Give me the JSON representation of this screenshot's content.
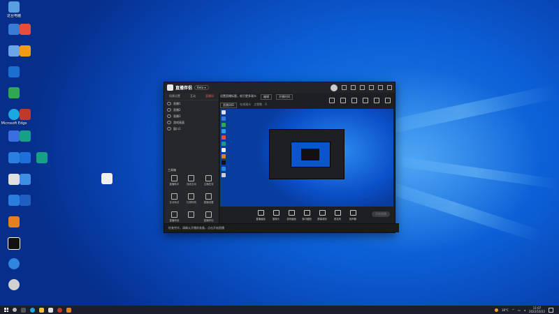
{
  "desktop": {
    "icons": [
      {
        "label": "这台电脑",
        "color": "#5aa0e0"
      },
      {
        "label": "",
        "color": "#3a7bd5"
      },
      {
        "label": "",
        "color": "#6aa6e8"
      },
      {
        "label": "",
        "color": "#1a6fd0"
      },
      {
        "label": "",
        "color": "#2fa84f"
      },
      {
        "label": "Microsoft Edge",
        "color": "#1ca7e0"
      },
      {
        "label": "",
        "color": "#3b6ee0"
      },
      {
        "label": "",
        "color": "#2a7fe0"
      },
      {
        "label": "",
        "color": "#e0e0e0"
      },
      {
        "label": "",
        "color": "#2b7de0"
      },
      {
        "label": "",
        "color": "#e67e22"
      },
      {
        "label": "",
        "color": "#111111"
      },
      {
        "label": "",
        "color": "#2e86de"
      },
      {
        "label": "",
        "color": "#d0d0d0"
      },
      {
        "label": "",
        "color": "#e74c3c"
      },
      {
        "label": "",
        "color": "#f39c12"
      },
      {
        "label": "",
        "color": "#c0392b"
      },
      {
        "label": "",
        "color": "#16a085"
      },
      {
        "label": "",
        "color": "#1e6fd9"
      },
      {
        "label": "",
        "color": "#3d8fe3"
      },
      {
        "label": "",
        "color": "#1f5fbf"
      },
      {
        "label": "",
        "color": "#f0f0f0"
      }
    ]
  },
  "app": {
    "title": "直播伴侣",
    "version_pill": "Beta ▾",
    "left_tabs": [
      "场景设置",
      "互动",
      "直播间"
    ],
    "scenes": [
      "直播1",
      "直播2",
      "直播3",
      "游戏画面",
      "窗口1"
    ],
    "tools_title": "工具箱",
    "tools": [
      "直播助手",
      "连线互动",
      "主播任务",
      "互动玩法",
      "礼物特效",
      "直播设置",
      "直播商品",
      "",
      "直播伴侣"
    ],
    "info_line1": [
      "设置直播标题，吸引更多观众",
      "编辑",
      "开播时间"
    ],
    "info_line2": [
      "直播间ID",
      "在线观众",
      "点赞数",
      "0"
    ],
    "controls": [
      "直播画面",
      "摄像头",
      "游戏画面",
      "窗口截图",
      "屏幕录制",
      "麦克风",
      "扬声器"
    ],
    "live_button": "开始直播",
    "status_text": "检查完毕，请确认开播前准备，点击开始直播"
  },
  "taskbar": {
    "weather": "18°C",
    "time": "11:07",
    "date": "2022/10/22"
  }
}
